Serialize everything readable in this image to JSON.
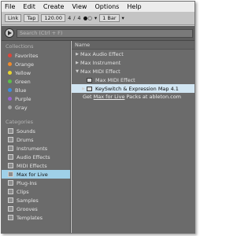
{
  "menubar": {
    "items": [
      "File",
      "Edit",
      "Create",
      "View",
      "Options",
      "Help"
    ]
  },
  "control_bar": {
    "link_label": "Link",
    "tap_label": "Tap",
    "tempo": "120.00",
    "time_sig_num": "4",
    "time_sig_sep": "/",
    "time_sig_den": "4",
    "metronome": "●○",
    "bar_select": "1 Bar",
    "dropdown_glyph": "▾"
  },
  "search": {
    "placeholder": "Search (Ctrl + F)"
  },
  "sidebar": {
    "collections_header": "Collections",
    "collections": [
      {
        "label": "Favorites",
        "color": "#e0443a"
      },
      {
        "label": "Orange",
        "color": "#f08a2a"
      },
      {
        "label": "Yellow",
        "color": "#e8d52e"
      },
      {
        "label": "Green",
        "color": "#5cbf4a"
      },
      {
        "label": "Blue",
        "color": "#3d8de0"
      },
      {
        "label": "Purple",
        "color": "#9a62cf"
      },
      {
        "label": "Gray",
        "color": "#a3a3a3"
      }
    ],
    "categories_header": "Categories",
    "categories": [
      {
        "label": "Sounds",
        "icon": "sounds-icon"
      },
      {
        "label": "Drums",
        "icon": "drums-icon"
      },
      {
        "label": "Instruments",
        "icon": "instruments-icon"
      },
      {
        "label": "Audio Effects",
        "icon": "audio-effects-icon"
      },
      {
        "label": "MIDI Effects",
        "icon": "midi-effects-icon"
      },
      {
        "label": "Max for Live",
        "icon": "max-for-live-icon",
        "selected": true
      },
      {
        "label": "Plug-Ins",
        "icon": "plug-ins-icon"
      },
      {
        "label": "Clips",
        "icon": "clips-icon"
      },
      {
        "label": "Samples",
        "icon": "samples-icon"
      },
      {
        "label": "Grooves",
        "icon": "grooves-icon"
      },
      {
        "label": "Templates",
        "icon": "templates-icon"
      }
    ]
  },
  "browser": {
    "column_header": "Name",
    "rows": [
      {
        "label": "Max Audio Effect",
        "indent": 0,
        "arrow": "▶",
        "icon": false
      },
      {
        "label": "Max Instrument",
        "indent": 0,
        "arrow": "▶",
        "icon": false
      },
      {
        "label": "Max MIDI Effect",
        "indent": 0,
        "arrow": "▼",
        "icon": false
      },
      {
        "label": "Max MIDI Effect",
        "indent": 1,
        "arrow": "",
        "icon": true
      },
      {
        "label": "KeySwitch & Expression Map 4.1",
        "indent": 1,
        "arrow": "▶",
        "icon": true,
        "selected": true
      }
    ],
    "link_prefix": "Get ",
    "link_text": "Max for Live",
    "link_suffix": " Packs at ableton.com"
  }
}
